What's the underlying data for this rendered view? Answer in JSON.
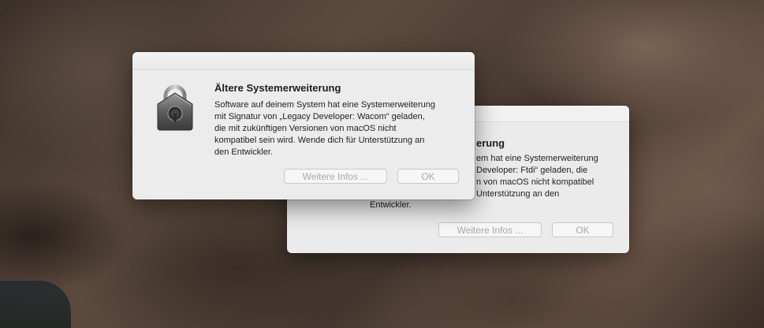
{
  "dialog_back": {
    "title": "Ältere Systemerweiterung",
    "title_visible": "erung",
    "body_lines": [
      "em hat eine Systemerweiterung",
      "Developer: Ftdi“ geladen, die",
      "n von macOS nicht kompatibel",
      "Unterstützung an den",
      "Entwickler."
    ],
    "more_info_button": "Weitere Infos ...",
    "ok_button": "OK"
  },
  "dialog_front": {
    "icon": "gatekeeper-lock-icon",
    "title": "Ältere Systemerweiterung",
    "body_lines": [
      "Software auf deinem System hat eine Systemerweiterung",
      "mit Signatur von „Legacy Developer: Wacom“ geladen,",
      "die mit zukünftigen Versionen von macOS nicht",
      "kompatibel sein wird. Wende dich für Unterstützung an",
      "den Entwickler."
    ],
    "more_info_button": "Weitere Infos ...",
    "ok_button": "OK"
  }
}
